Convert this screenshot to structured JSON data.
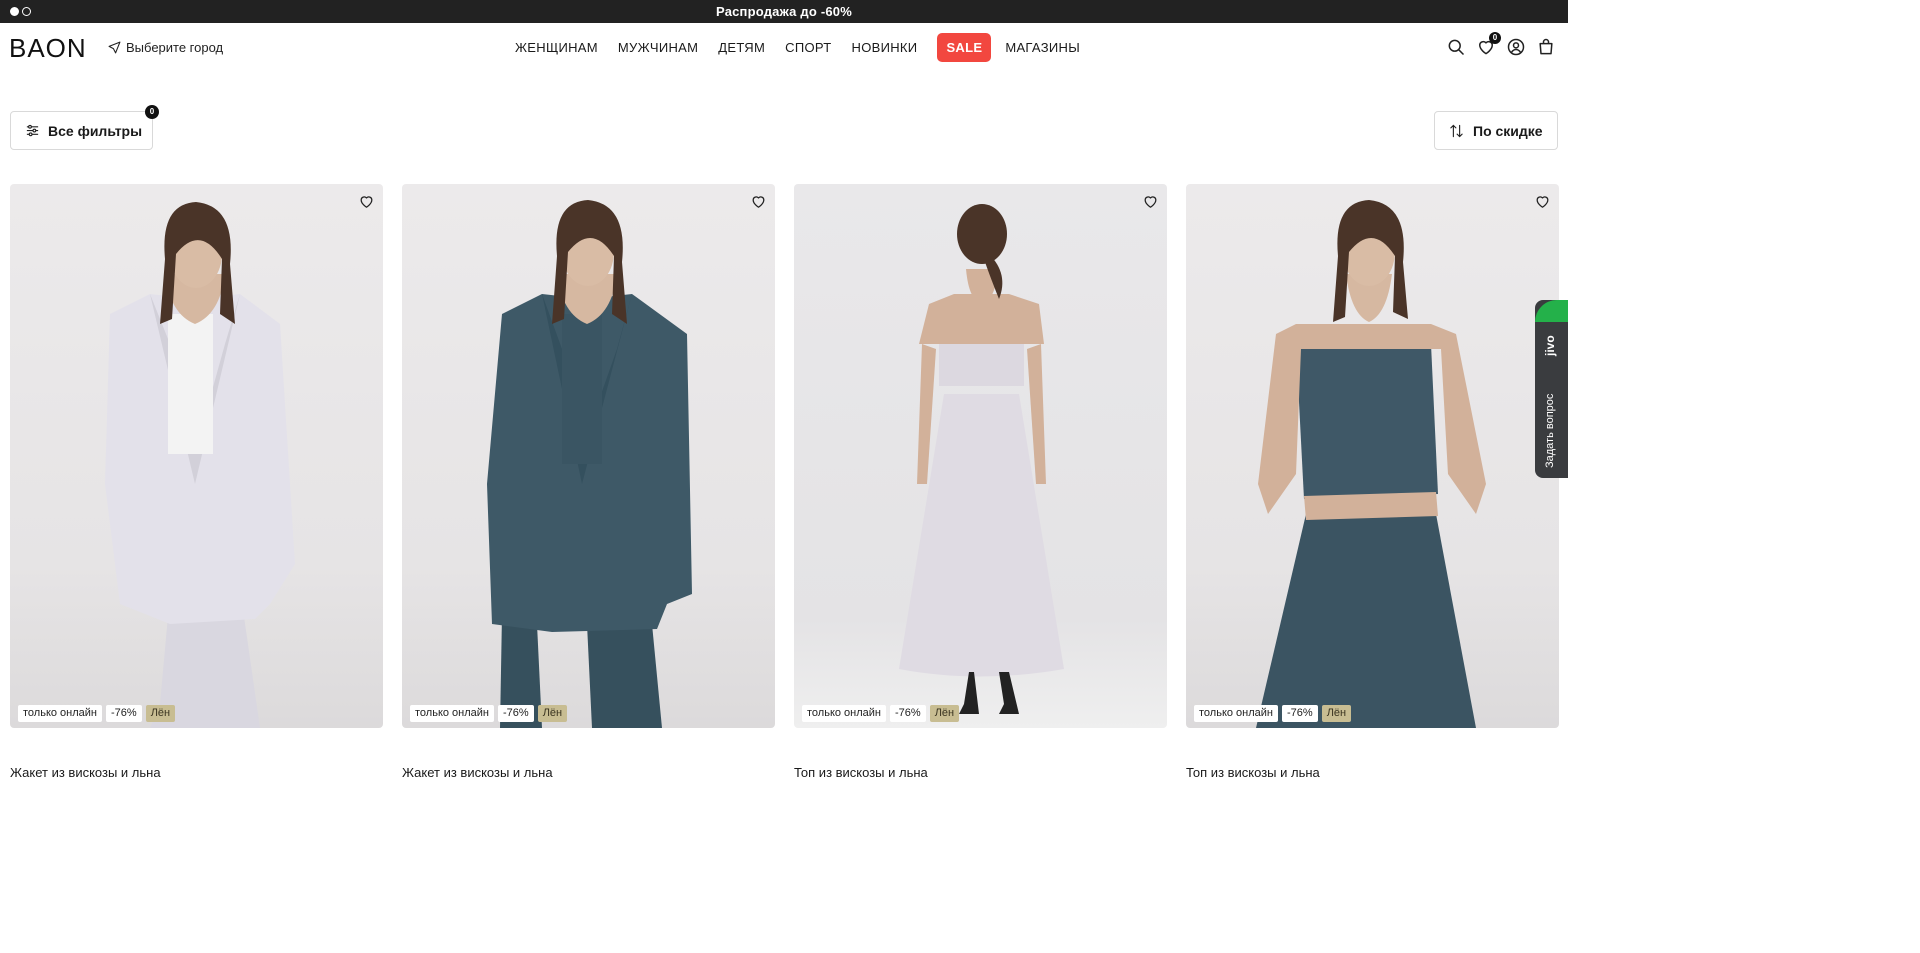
{
  "promo": {
    "text": "Распродажа до -60%",
    "slides": 2,
    "active_slide": 1
  },
  "header": {
    "logo": "BAON",
    "city_label": "Выберите город",
    "nav": [
      "ЖЕНЩИНАМ",
      "МУЖЧИНАМ",
      "ДЕТЯМ",
      "СПОРТ",
      "НОВИНКИ",
      "SALE",
      "МАГАЗИНЫ"
    ],
    "icons": [
      "search-icon",
      "heart-icon",
      "user-icon",
      "bag-icon"
    ],
    "favorites_count": "0"
  },
  "toolbar": {
    "filters_label": "Все фильтры",
    "filters_count": "0",
    "sort_label": "По скидке"
  },
  "products": [
    {
      "title": "Жакет из вискозы и льна",
      "badges": [
        "только онлайн",
        "-76%",
        "Лён"
      ],
      "color": "#e3e1ea"
    },
    {
      "title": "Жакет из вискозы и льна",
      "badges": [
        "только онлайн",
        "-76%",
        "Лён"
      ],
      "color": "#3e5967"
    },
    {
      "title": "Топ из вискозы и льна",
      "badges": [
        "только онлайн",
        "-76%",
        "Лён"
      ],
      "color": "#dfdbe3"
    },
    {
      "title": "Топ из вискозы и льна",
      "badges": [
        "только онлайн",
        "-76%",
        "Лён"
      ],
      "color": "#3f5867"
    }
  ],
  "chat_widget": {
    "brand": "jivo",
    "label": "Задать вопрос"
  },
  "colors": {
    "sale": "#f2473f",
    "promo_bg": "#222222",
    "linen_badge": "#c8bd92",
    "jivo_bg": "#3a3c3f",
    "jivo_accent": "#24b14a"
  }
}
